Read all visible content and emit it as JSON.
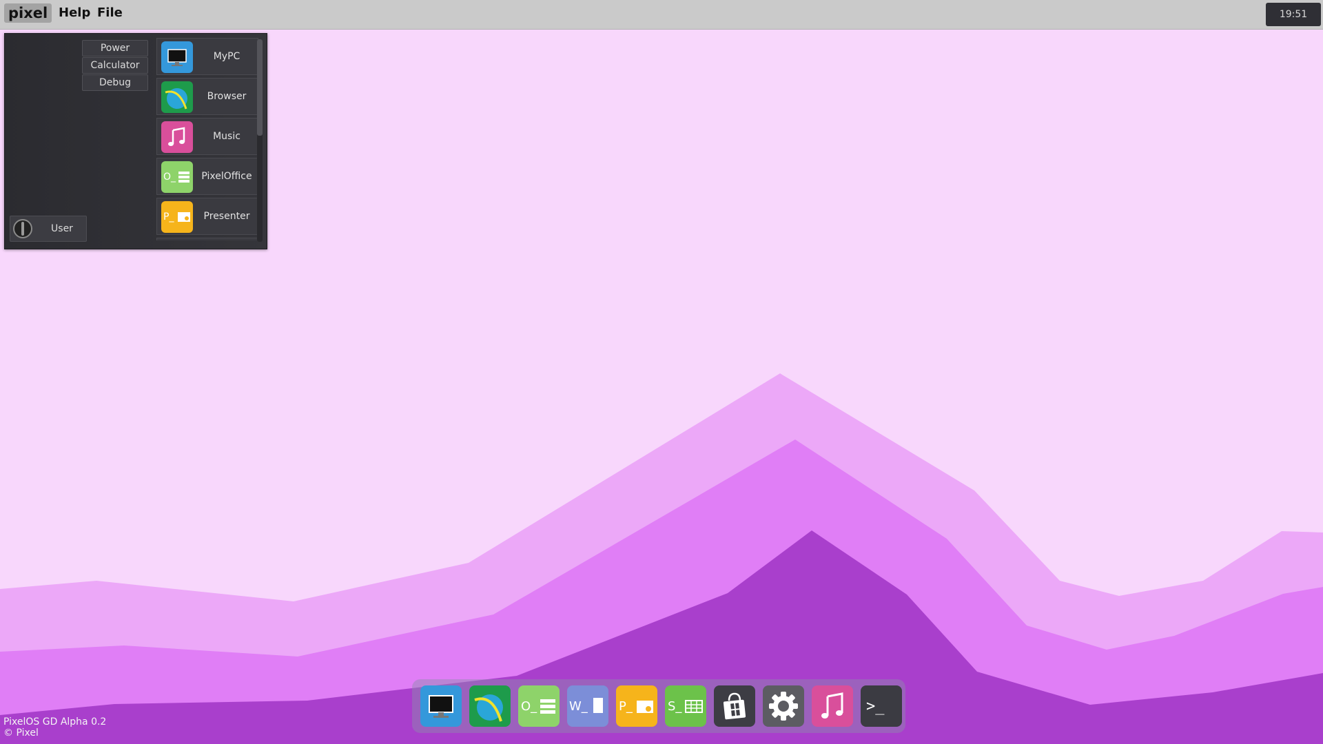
{
  "topbar": {
    "logo": "pixel",
    "menu": [
      {
        "label": "Help"
      },
      {
        "label": "File"
      }
    ],
    "clock": "19:51"
  },
  "start_menu": {
    "side_buttons": [
      {
        "label": "Power"
      },
      {
        "label": "Calculator"
      },
      {
        "label": "Debug"
      }
    ],
    "user": {
      "label": "User"
    },
    "apps": [
      {
        "label": "MyPC",
        "icon": "monitor-icon",
        "color": "#3498db"
      },
      {
        "label": "Browser",
        "icon": "browser-globe-icon",
        "color": "#1e9b4b"
      },
      {
        "label": "Music",
        "icon": "music-note-icon",
        "color": "#d94f9b"
      },
      {
        "label": "PixelOffice",
        "icon": "office-icon",
        "color": "#8ed36a"
      },
      {
        "label": "Presenter",
        "icon": "presenter-icon",
        "color": "#f6b41b"
      }
    ]
  },
  "dock": {
    "items": [
      {
        "name": "mypc",
        "icon": "monitor-icon",
        "color": "#3498db"
      },
      {
        "name": "browser",
        "icon": "browser-globe-icon",
        "color": "#1e9b4b"
      },
      {
        "name": "pixeloffice",
        "icon": "office-icon",
        "color": "#8ed36a"
      },
      {
        "name": "writer",
        "icon": "writer-icon",
        "color": "#7c8ed8"
      },
      {
        "name": "presenter",
        "icon": "presenter-icon",
        "color": "#f6b41b"
      },
      {
        "name": "sheets",
        "icon": "sheets-icon",
        "color": "#6cc24a"
      },
      {
        "name": "store",
        "icon": "store-bag-icon",
        "color": "#3d3d44"
      },
      {
        "name": "settings",
        "icon": "gear-icon",
        "color": "#5c5c62"
      },
      {
        "name": "music",
        "icon": "music-note-icon",
        "color": "#d94f9b"
      },
      {
        "name": "terminal",
        "icon": "terminal-icon",
        "color": "#3b3b42"
      }
    ],
    "glyphs": {
      "office": "O_",
      "writer": "W_",
      "presenter": "P_",
      "sheets": "S_",
      "terminal": ">_"
    }
  },
  "footer": {
    "line1": "PixelOS GD Alpha 0.2",
    "line2": "© Pixel"
  },
  "wallpaper": {
    "sky": "#f8d7fc",
    "layer1": "#eca8f8",
    "layer2": "#e07ef6",
    "layer3": "#a93fcc"
  }
}
